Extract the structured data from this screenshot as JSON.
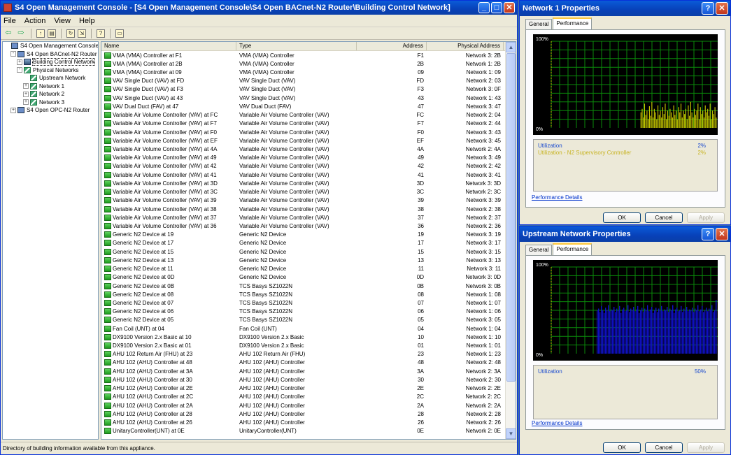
{
  "main": {
    "title": "S4 Open Management Console - [S4 Open Management Console\\S4 Open BACnet-N2 Router\\Building Control Network]",
    "menu": [
      "File",
      "Action",
      "View",
      "Help"
    ],
    "status": "Directory of building information available from this appliance.",
    "tree": [
      {
        "label": "S4 Open Management Console",
        "level": 0,
        "exp": "",
        "icon": "comp"
      },
      {
        "label": "S4 Open BACnet-N2 Router",
        "level": 1,
        "exp": "-",
        "icon": "comp"
      },
      {
        "label": "Building Control Network",
        "level": 2,
        "exp": "+",
        "icon": "bld",
        "selected": true
      },
      {
        "label": "Physical Networks",
        "level": 2,
        "exp": "-",
        "icon": "net"
      },
      {
        "label": "Upstream Network",
        "level": 3,
        "exp": "",
        "icon": "net"
      },
      {
        "label": "Network 1",
        "level": 3,
        "exp": "+",
        "icon": "net"
      },
      {
        "label": "Network 2",
        "level": 3,
        "exp": "+",
        "icon": "net"
      },
      {
        "label": "Network 3",
        "level": 3,
        "exp": "+",
        "icon": "net"
      },
      {
        "label": "S4 Open OPC-N2 Router",
        "level": 1,
        "exp": "+",
        "icon": "comp"
      }
    ],
    "columns": {
      "name": "Name",
      "type": "Type",
      "address": "Address",
      "physical": "Physical Address"
    },
    "rows": [
      [
        "VMA (VMA) Controller at F1",
        "VMA (VMA) Controller",
        "F1",
        "Network 3: 2B"
      ],
      [
        "VMA (VMA) Controller at 2B",
        "VMA (VMA) Controller",
        "2B",
        "Network 1: 2B"
      ],
      [
        "VMA (VMA) Controller at 09",
        "VMA (VMA) Controller",
        "09",
        "Network 1: 09"
      ],
      [
        "VAV Single Duct (VAV) at FD",
        "VAV Single Duct (VAV)",
        "FD",
        "Network 2: 03"
      ],
      [
        "VAV Single Duct (VAV) at F3",
        "VAV Single Duct (VAV)",
        "F3",
        "Network 3: 0F"
      ],
      [
        "VAV Single Duct (VAV) at 43",
        "VAV Single Duct (VAV)",
        "43",
        "Network 1: 43"
      ],
      [
        "VAV Dual Duct (FAV) at 47",
        "VAV Dual Duct (FAV)",
        "47",
        "Network 3: 47"
      ],
      [
        "Variable Air Volume Controller (VAV) at FC",
        "Variable Air Volume Controller (VAV)",
        "FC",
        "Network 2: 04"
      ],
      [
        "Variable Air Volume Controller (VAV) at F7",
        "Variable Air Volume Controller (VAV)",
        "F7",
        "Network 2: 44"
      ],
      [
        "Variable Air Volume Controller (VAV) at F0",
        "Variable Air Volume Controller (VAV)",
        "F0",
        "Network 3: 43"
      ],
      [
        "Variable Air Volume Controller (VAV) at EF",
        "Variable Air Volume Controller (VAV)",
        "EF",
        "Network 3: 45"
      ],
      [
        "Variable Air Volume Controller (VAV) at 4A",
        "Variable Air Volume Controller (VAV)",
        "4A",
        "Network 2: 4A"
      ],
      [
        "Variable Air Volume Controller (VAV) at 49",
        "Variable Air Volume Controller (VAV)",
        "49",
        "Network 3: 49"
      ],
      [
        "Variable Air Volume Controller (VAV) at 42",
        "Variable Air Volume Controller (VAV)",
        "42",
        "Network 2: 42"
      ],
      [
        "Variable Air Volume Controller (VAV) at 41",
        "Variable Air Volume Controller (VAV)",
        "41",
        "Network 3: 41"
      ],
      [
        "Variable Air Volume Controller (VAV) at 3D",
        "Variable Air Volume Controller (VAV)",
        "3D",
        "Network 3: 3D"
      ],
      [
        "Variable Air Volume Controller (VAV) at 3C",
        "Variable Air Volume Controller (VAV)",
        "3C",
        "Network 2: 3C"
      ],
      [
        "Variable Air Volume Controller (VAV) at 39",
        "Variable Air Volume Controller (VAV)",
        "39",
        "Network 3: 39"
      ],
      [
        "Variable Air Volume Controller (VAV) at 38",
        "Variable Air Volume Controller (VAV)",
        "38",
        "Network 2: 38"
      ],
      [
        "Variable Air Volume Controller (VAV) at 37",
        "Variable Air Volume Controller (VAV)",
        "37",
        "Network 2: 37"
      ],
      [
        "Variable Air Volume Controller (VAV) at 36",
        "Variable Air Volume Controller (VAV)",
        "36",
        "Network 2: 36"
      ],
      [
        "Generic N2 Device at 19",
        "Generic N2 Device",
        "19",
        "Network 3: 19"
      ],
      [
        "Generic N2 Device at 17",
        "Generic N2 Device",
        "17",
        "Network 3: 17"
      ],
      [
        "Generic N2 Device at 15",
        "Generic N2 Device",
        "15",
        "Network 3: 15"
      ],
      [
        "Generic N2 Device at 13",
        "Generic N2 Device",
        "13",
        "Network 3: 13"
      ],
      [
        "Generic N2 Device at 11",
        "Generic N2 Device",
        "11",
        "Network 3: 11"
      ],
      [
        "Generic N2 Device at 0D",
        "Generic N2 Device",
        "0D",
        "Network 3: 0D"
      ],
      [
        "Generic N2 Device at 0B",
        "TCS Basys SZ1022N",
        "0B",
        "Network 3: 0B"
      ],
      [
        "Generic N2 Device at 08",
        "TCS Basys SZ1022N",
        "08",
        "Network 1: 08"
      ],
      [
        "Generic N2 Device at 07",
        "TCS Basys SZ1022N",
        "07",
        "Network 1: 07"
      ],
      [
        "Generic N2 Device at 06",
        "TCS Basys SZ1022N",
        "06",
        "Network 1: 06"
      ],
      [
        "Generic N2 Device at 05",
        "TCS Basys SZ1022N",
        "05",
        "Network 3: 05"
      ],
      [
        "Fan Coil (UNT) at 04",
        "Fan Coil (UNT)",
        "04",
        "Network 1: 04"
      ],
      [
        "DX9100 Version 2.x Basic at 10",
        "DX9100 Version 2.x Basic",
        "10",
        "Network 1: 10"
      ],
      [
        "DX9100 Version 2.x Basic at 01",
        "DX9100 Version 2.x Basic",
        "01",
        "Network 1: 01"
      ],
      [
        "AHU 102 Return Air (FHU) at 23",
        "AHU 102 Return Air (FHU)",
        "23",
        "Network 1: 23"
      ],
      [
        "AHU 102 (AHU) Controller at 48",
        "AHU 102 (AHU) Controller",
        "48",
        "Network 2: 48"
      ],
      [
        "AHU 102 (AHU) Controller at 3A",
        "AHU 102 (AHU) Controller",
        "3A",
        "Network 2: 3A"
      ],
      [
        "AHU 102 (AHU) Controller at 30",
        "AHU 102 (AHU) Controller",
        "30",
        "Network 2: 30"
      ],
      [
        "AHU 102 (AHU) Controller at 2E",
        "AHU 102 (AHU) Controller",
        "2E",
        "Network 2: 2E"
      ],
      [
        "AHU 102 (AHU) Controller at 2C",
        "AHU 102 (AHU) Controller",
        "2C",
        "Network 2: 2C"
      ],
      [
        "AHU 102 (AHU) Controller at 2A",
        "AHU 102 (AHU) Controller",
        "2A",
        "Network 2: 2A"
      ],
      [
        "AHU 102 (AHU) Controller at 28",
        "AHU 102 (AHU) Controller",
        "28",
        "Network 2: 28"
      ],
      [
        "AHU 102 (AHU) Controller at 26",
        "AHU 102 (AHU) Controller",
        "26",
        "Network 2: 26"
      ],
      [
        "UnitaryController(UNT) at 0E",
        "UnitaryController(UNT)",
        "0E",
        "Network 2: 0E"
      ]
    ]
  },
  "dialog1": {
    "title": "Network 1 Properties",
    "tabs": [
      "General",
      "Performance"
    ],
    "graph_top": "100%",
    "graph_bottom": "0%",
    "legend": [
      {
        "name": "Utilization",
        "value": "2%"
      },
      {
        "name": "Utilization - N2 Supervisory Controller",
        "value": "2%"
      }
    ],
    "link": "Performance Details",
    "ok": "OK",
    "cancel": "Cancel",
    "apply": "Apply",
    "bar_color": "#c8c800",
    "bars": [
      0,
      0,
      0,
      0,
      0,
      0,
      0,
      0,
      0,
      0,
      0,
      0,
      0,
      0,
      0,
      0,
      0,
      0,
      0,
      0,
      0,
      0,
      0,
      0,
      0,
      0,
      0,
      0,
      0,
      0,
      0,
      0,
      0,
      0,
      0,
      0,
      0,
      0,
      0,
      0,
      0,
      0,
      0,
      0,
      0,
      0,
      0,
      0,
      0,
      0,
      0,
      0,
      0,
      0,
      0,
      0,
      0,
      0,
      0,
      0,
      0,
      0,
      0,
      0,
      0,
      0,
      0,
      0,
      0,
      0,
      0,
      0,
      0,
      0.18,
      0.22,
      0.12,
      0.28,
      0.15,
      0.2,
      0.1,
      0.25,
      0.14,
      0.3,
      0.12,
      0.22,
      0.18,
      0.1,
      0.26,
      0.15,
      0.2,
      0.12,
      0.24,
      0.16,
      0.28,
      0.1,
      0.2,
      0.14,
      0.22,
      0.18,
      0.12,
      0.26,
      0.15,
      0.2,
      0.1,
      0.24,
      0.18,
      0.28,
      0.12,
      0.2,
      0.16,
      0.22,
      0.1,
      0.26,
      0.14,
      0.3,
      0.18,
      0.12,
      0.22,
      0.15,
      0.2,
      0.28,
      0.1,
      0.24,
      0.16,
      0.2,
      0.12,
      0.26,
      0.18,
      0.22,
      0.14,
      0.28,
      0.1,
      0.2,
      0.16,
      0.24,
      0.12
    ]
  },
  "dialog2": {
    "title": "Upstream Network Properties",
    "tabs": [
      "General",
      "Performance"
    ],
    "graph_top": "100%",
    "graph_bottom": "0%",
    "legend": [
      {
        "name": "Utilization",
        "value": "50%"
      }
    ],
    "link": "Performance Details",
    "ok": "OK",
    "cancel": "Cancel",
    "apply": "Apply",
    "bar_color": "#1010c8",
    "bars": [
      0,
      0,
      0,
      0,
      0,
      0,
      0,
      0,
      0,
      0,
      0,
      0,
      0,
      0,
      0,
      0,
      0,
      0,
      0,
      0,
      0,
      0,
      0,
      0,
      0,
      0,
      0,
      0,
      0,
      0,
      0,
      0,
      0.5,
      0.52,
      0.48,
      0.55,
      0.5,
      0.47,
      0.53,
      0.5,
      0.56,
      0.49,
      0.51,
      0.5,
      0.54,
      0.48,
      0.52,
      0.5,
      0.55,
      0.47,
      0.51,
      0.53,
      0.49,
      0.5,
      0.56,
      0.48,
      0.52,
      0.5,
      0.54,
      0.49,
      0.51,
      0.55,
      0.47,
      0.5,
      0.53,
      0.48,
      0.52,
      0.5,
      0.56,
      0.49,
      0.51,
      0.54,
      0.47,
      0.5,
      0.53,
      0.48,
      0.52,
      0.5,
      0.55,
      0.49,
      0.51,
      0.5,
      0.54,
      0.48,
      0.52,
      0.5,
      0.56,
      0.47,
      0.51,
      0.53,
      0.49,
      0.5,
      0.55,
      0.48,
      0.52,
      0.5,
      0.54,
      0.49,
      0.51,
      0.5,
      0.53,
      0.48,
      0.52,
      0.5,
      0.56,
      0.49,
      0.51,
      0.55,
      0.48,
      0.5,
      0.53,
      0.49,
      0.52,
      0.51,
      0.56,
      0.48,
      0.5,
      0.62
    ]
  }
}
